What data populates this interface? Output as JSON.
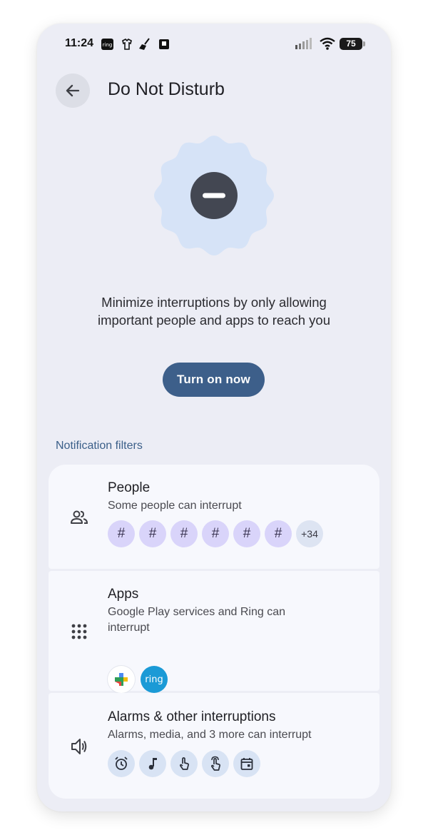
{
  "status_bar": {
    "time": "11:24",
    "battery": "75",
    "notif_icons": [
      "ring-icon",
      "shirt-icon",
      "broom-icon",
      "book-icon"
    ]
  },
  "header": {
    "title": "Do Not Disturb"
  },
  "hero": {
    "description_line1": "Minimize interruptions by only allowing",
    "description_line2": "important people and apps to reach you",
    "button_label": "Turn on now"
  },
  "section_label": "Notification filters",
  "people": {
    "title": "People",
    "subtitle": "Some people can interrupt",
    "chips": [
      "#",
      "#",
      "#",
      "#",
      "#",
      "#"
    ],
    "more": "+34"
  },
  "apps": {
    "title": "Apps",
    "subtitle_line1": "Google Play services and Ring can",
    "subtitle_line2": "interrupt",
    "ring_label": "ring"
  },
  "alarms": {
    "title": "Alarms & other interruptions",
    "subtitle": "Alarms, media, and 3 more can interrupt",
    "icons": [
      "alarm-icon",
      "music-note-icon",
      "touch-icon",
      "touch-hold-icon",
      "calendar-icon"
    ]
  },
  "colors": {
    "accent": "#3d5f8a",
    "hero_bg": "#d6e3f7",
    "hero_icon": "#434752",
    "chip_purple": "#d9d4fa",
    "card_bg": "#f7f8fd"
  }
}
